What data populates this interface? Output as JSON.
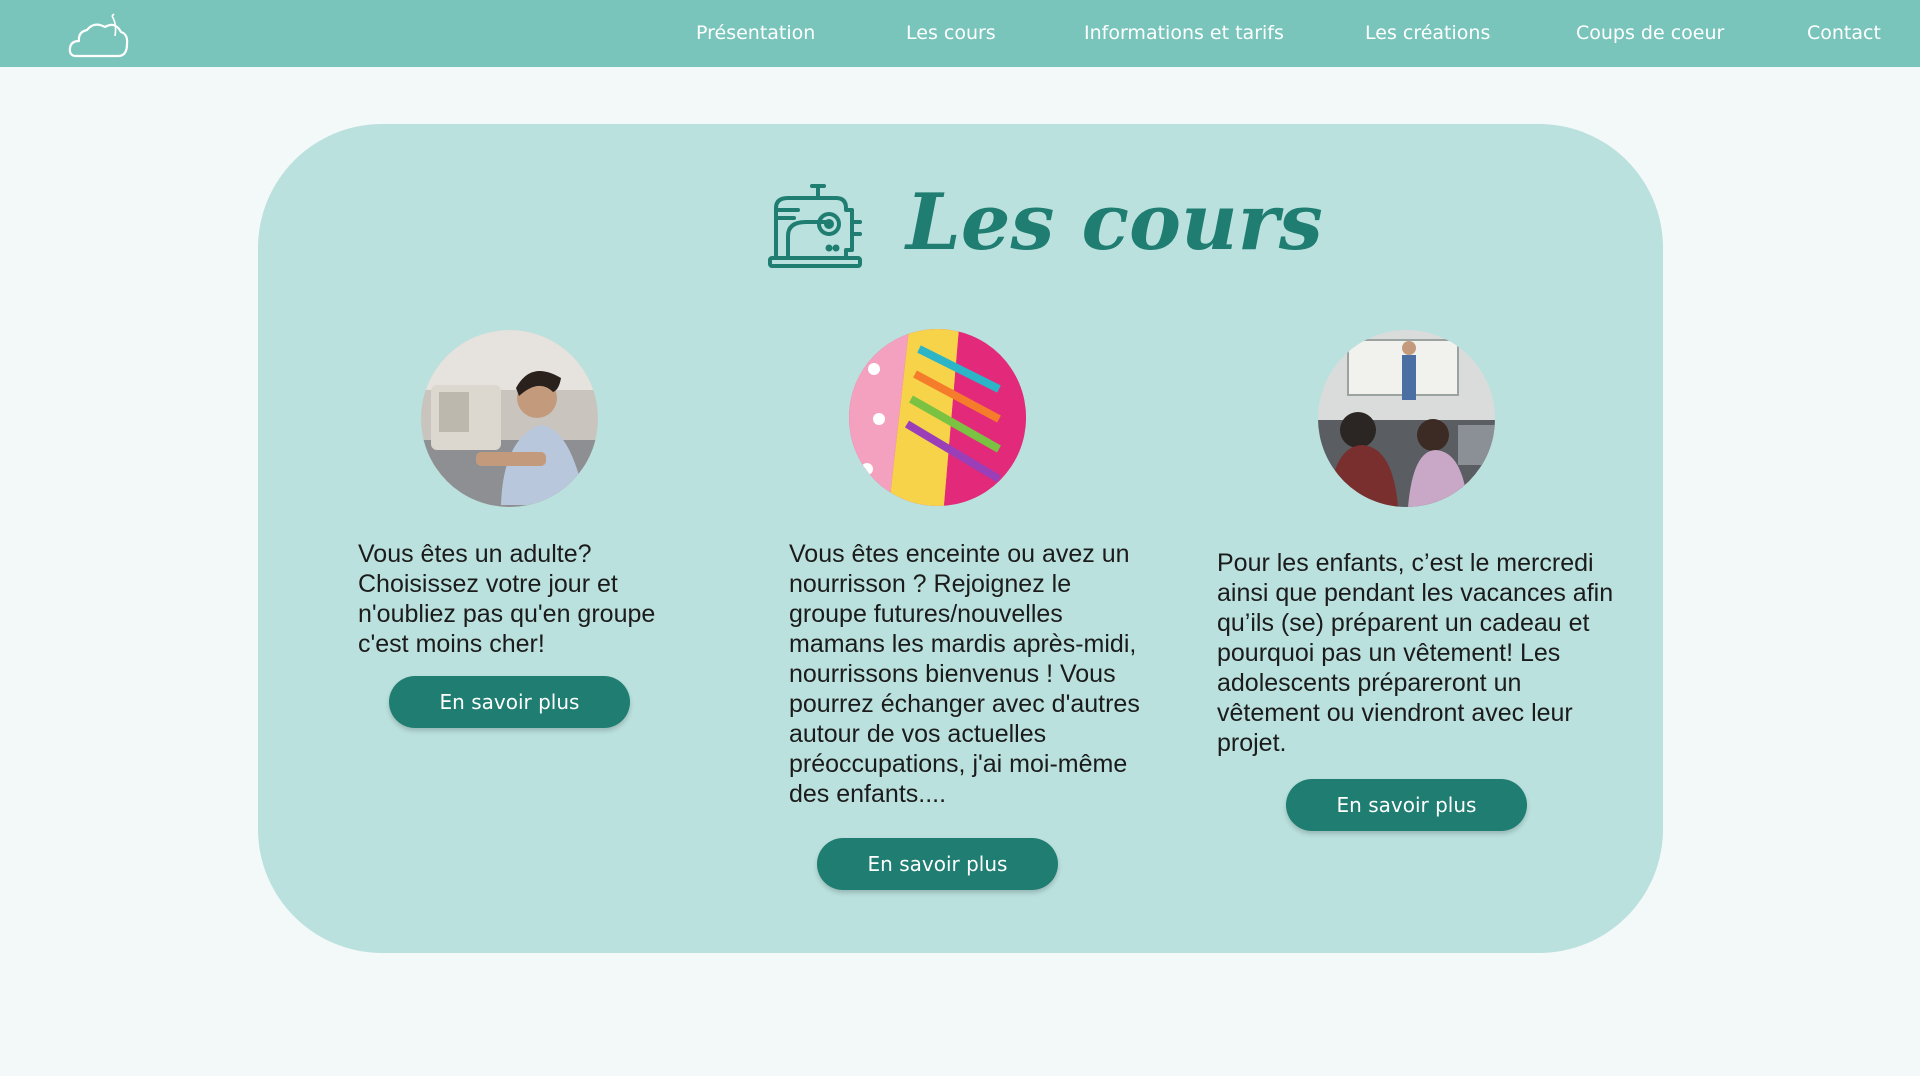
{
  "nav": {
    "logo_icon": "cloud-needle-logo",
    "items": [
      {
        "label": "Présentation"
      },
      {
        "label": "Les cours"
      },
      {
        "label": "Informations et tarifs"
      },
      {
        "label": "Les créations"
      },
      {
        "label": "Coups de coeur"
      },
      {
        "label": "Contact"
      }
    ]
  },
  "section": {
    "icon": "sewing-machine-icon",
    "title": "Les cours"
  },
  "courses": [
    {
      "photo": "adult-sewing-photo",
      "text": "Vous êtes un adulte? Choisissez votre jour et n'oubliez pas qu'en groupe c'est moins cher!",
      "button": "En savoir plus"
    },
    {
      "photo": "colorful-fabrics-photo",
      "text": "Vous êtes enceinte ou avez un nourrisson ? Rejoignez le groupe futures/nouvelles mamans les mardis après-midi, nourrissons bienvenus ! Vous pourrez échanger avec d'autres autour de vos actuelles préoccupations, j'ai moi-même des enfants....",
      "button": "En savoir plus"
    },
    {
      "photo": "classroom-photo",
      "text": "Pour les enfants, c’est le mercredi ainsi que pendant les vacances afin qu’ils (se) préparent un cadeau et pourquoi pas un vêtement! Les adolescents prépareront un vêtement ou viendront avec leur projet.",
      "button": "En savoir plus"
    }
  ],
  "colors": {
    "nav_bg": "#79c5bb",
    "card_bg": "#bae1de",
    "accent": "#1f7d71",
    "page_bg": "#f3f9f8"
  }
}
